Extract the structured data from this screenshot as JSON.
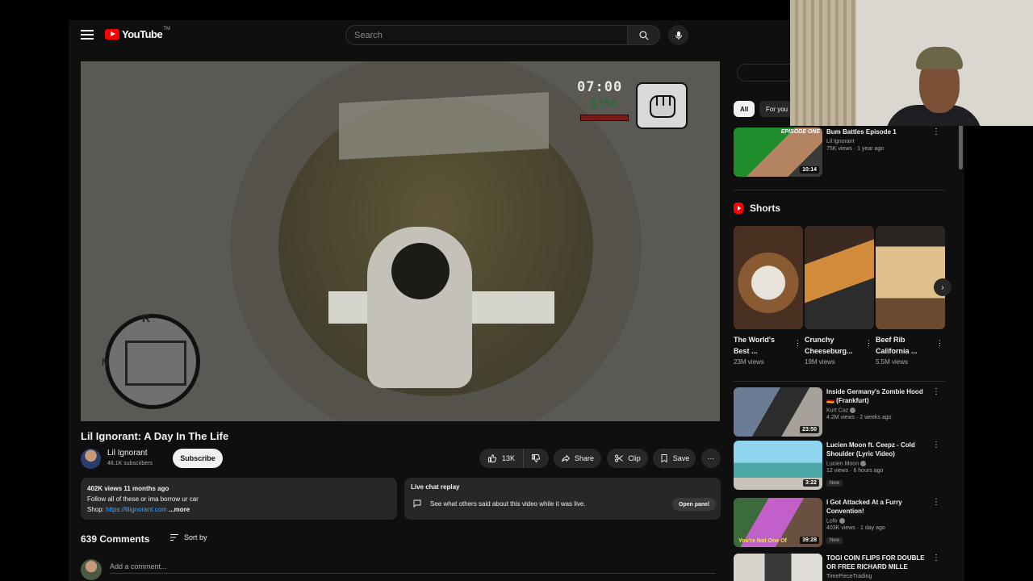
{
  "header": {
    "logo_text": "YouTube",
    "logo_sup": "TM",
    "search_placeholder": "Search"
  },
  "player": {
    "hud_time": "07:00",
    "hud_money": "$350",
    "radar_north": "N",
    "radar_r": "R"
  },
  "video": {
    "title": "Lil Ignorant: A Day In The Life",
    "channel": "Lil Ignorant",
    "subscribers": "48.1K subscribers",
    "subscribe_label": "Subscribe",
    "likes": "13K",
    "share_label": "Share",
    "clip_label": "Clip",
    "save_label": "Save",
    "more_label": "⋯"
  },
  "description": {
    "meta": "402K views  11 months ago",
    "line1": "Follow all of these or ima borrow ur car",
    "shop_label": "Shop: ",
    "shop_link": "https://lilignorant.com",
    "more_label": "...more"
  },
  "live_chat": {
    "title": "Live chat replay",
    "text": "See what others said about this video while it was live.",
    "open_panel": "Open panel"
  },
  "comments": {
    "count_label": "639 Comments",
    "sort_label": "Sort by",
    "add_placeholder": "Add a comment..."
  },
  "chips": {
    "all": "All",
    "for_you": "For you"
  },
  "recs_top": [
    {
      "title": "Bum Battles Episode 1",
      "channel": "Lil Ignorant",
      "meta": "75K views · 1 year ago",
      "duration": "10:14",
      "thumb_label": "EPISODE ONE"
    }
  ],
  "shorts": {
    "heading": "Shorts",
    "items": [
      {
        "title": "The World's Best ...",
        "views": "23M views"
      },
      {
        "title": "Crunchy Cheeseburg...",
        "views": "19M views"
      },
      {
        "title": "Beef Rib California ...",
        "views": "5.5M views"
      }
    ]
  },
  "recs_bottom": [
    {
      "title": "Inside Germany's Zombie Hood 🇩🇪 (Frankfurt)",
      "channel": "Kurt Caz",
      "meta": "4.2M views · 2 weeks ago",
      "duration": "23:50",
      "new": ""
    },
    {
      "title": "Lucien Moon ft. Ceepz - Cold Shoulder (Lyric Video)",
      "channel": "Lucien Moon",
      "meta": "12 views · 6 hours ago",
      "duration": "3:22",
      "new": "New"
    },
    {
      "title": "I Got Attacked At a Furry Convention!",
      "channel": "Lofe",
      "meta": "403K views · 1 day ago",
      "duration": "39:28",
      "new": "New",
      "thumb_label": "You're Not One Of"
    },
    {
      "title": "TOGI COIN FLIPS FOR DOUBLE OR FREE RICHARD MILLE",
      "channel": "TimePieceTrading",
      "meta": "",
      "duration": "",
      "new": ""
    }
  ],
  "colors": {
    "background": "#0f0f0f",
    "surface": "#272727",
    "brand_red": "#ff0000",
    "link": "#3ea6ff"
  }
}
